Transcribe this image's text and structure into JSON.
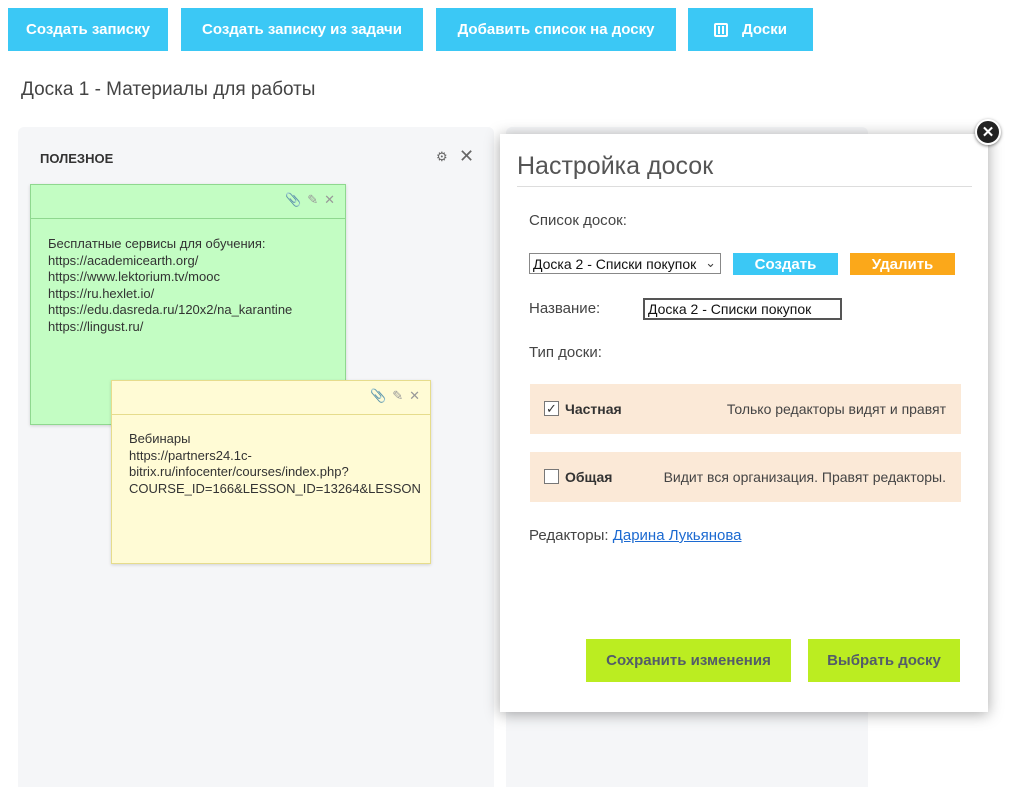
{
  "toolbar": {
    "create_note": "Создать записку",
    "create_note_from_task": "Создать записку из задачи",
    "add_list": "Добавить список на доску",
    "boards": "Доски"
  },
  "board_title": "Доска 1 - Материалы для работы",
  "column": {
    "title": "ПОЛЕЗНОЕ"
  },
  "notes": [
    {
      "color": "#c3fdc3",
      "text": "Бесплатные сервисы для обучения:\nhttps://academicearth.org/\nhttps://www.lektorium.tv/mooc\nhttps://ru.hexlet.io/\nhttps://edu.dasreda.ru/120x2/na_karantine\nhttps://lingust.ru/"
    },
    {
      "color": "#fffbd5",
      "text": "Вебинары\nhttps://partners24.1c-\nbitrix.ru/infocenter/courses/index.php?\nCOURSE_ID=166&LESSON_ID=13264&LESSON"
    }
  ],
  "modal": {
    "title": "Настройка досок",
    "list_label": "Список досок:",
    "selected_board": "Доска 2 - Списки покупок",
    "create_label": "Создать",
    "delete_label": "Удалить",
    "name_label": "Название:",
    "name_value": "Доска 2 - Списки покупок",
    "type_label": "Тип доски:",
    "types": [
      {
        "name": "Частная",
        "desc": "Только редакторы видят и правят",
        "checked": true
      },
      {
        "name": "Общая",
        "desc": "Видит вся организация. Правят редакторы.",
        "checked": false
      }
    ],
    "editors_label": "Редакторы:",
    "editor_name": "Дарина Лукьянова",
    "save_label": "Сохранить изменения",
    "choose_label": "Выбрать доску"
  },
  "colors": {
    "primary": "#3bc8f5",
    "danger": "#fba81a",
    "accept": "#bbed21",
    "type_row_bg": "#fbe9d7"
  }
}
